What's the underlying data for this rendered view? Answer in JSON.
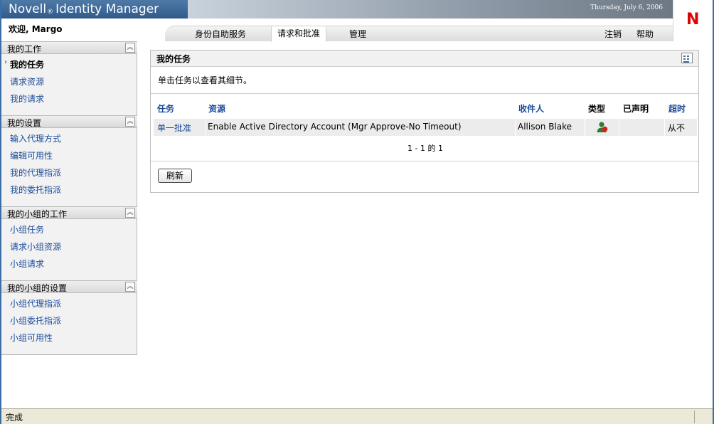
{
  "header": {
    "brand_name": "Novell",
    "brand_reg": "®",
    "brand_product": "Identity Manager",
    "date": "Thursday, July 6, 2006",
    "logo_letter": "N",
    "welcome": "欢迎, Margo"
  },
  "nav": {
    "tabs": [
      {
        "label": "身份自助服务"
      },
      {
        "label": "请求和批准"
      },
      {
        "label": "管理"
      }
    ],
    "logout": "注销",
    "help": "帮助"
  },
  "sidebar": {
    "sections": [
      {
        "title": "我的工作",
        "items": [
          {
            "label": "我的任务"
          },
          {
            "label": "请求资源"
          },
          {
            "label": "我的请求"
          }
        ]
      },
      {
        "title": "我的设置",
        "items": [
          {
            "label": "输入代理方式"
          },
          {
            "label": "编辑可用性"
          },
          {
            "label": "我的代理指派"
          },
          {
            "label": "我的委托指派"
          }
        ]
      },
      {
        "title": "我的小组的工作",
        "items": [
          {
            "label": "小组任务"
          },
          {
            "label": "请求小组资源"
          },
          {
            "label": "小组请求"
          }
        ]
      },
      {
        "title": "我的小组的设置",
        "items": [
          {
            "label": "小组代理指派"
          },
          {
            "label": "小组委托指派"
          },
          {
            "label": "小组可用性"
          }
        ]
      }
    ]
  },
  "main": {
    "panel_title": "我的任务",
    "instructions": "单击任务以查看其细节。",
    "columns": {
      "task": "任务",
      "resource": "资源",
      "recipient": "收件人",
      "type": "类型",
      "claimed": "已声明",
      "timeout": "超时"
    },
    "rows": [
      {
        "task": "单一批准",
        "resource": "Enable Active Directory Account (Mgr Approve-No Timeout)",
        "recipient": "Allison Blake",
        "type_icon": "user-role-icon",
        "claimed": "",
        "timeout": "从不"
      }
    ],
    "pager": "1 - 1 的 1",
    "refresh_label": "刷新"
  },
  "status": {
    "text": "完成"
  },
  "colors": {
    "link": "#1a4b9b",
    "brand_bar": "#2f5a8a",
    "logo_red": "#e00000"
  }
}
